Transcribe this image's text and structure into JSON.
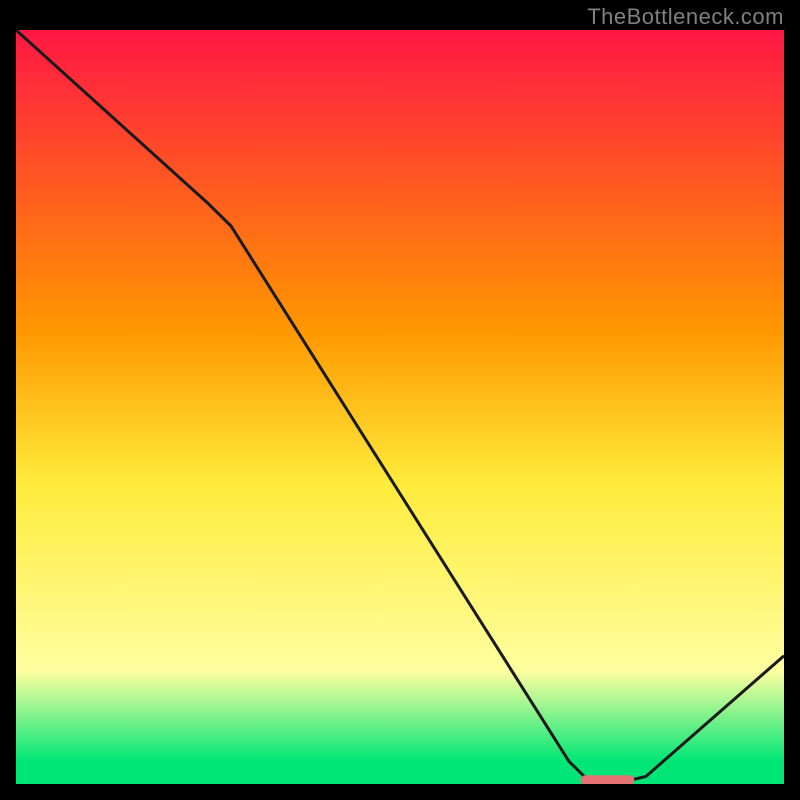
{
  "watermark": "TheBottleneck.com",
  "chart_data": {
    "type": "line",
    "title": "",
    "xlabel": "",
    "ylabel": "",
    "xlim": [
      0,
      100
    ],
    "ylim": [
      0,
      100
    ],
    "gradient_stops": [
      {
        "offset": 0,
        "color": "#ff1744"
      },
      {
        "offset": 40,
        "color": "#ff9800"
      },
      {
        "offset": 60,
        "color": "#ffeb3b"
      },
      {
        "offset": 85,
        "color": "#ffffa0"
      },
      {
        "offset": 97,
        "color": "#00e676"
      }
    ],
    "series": [
      {
        "name": "curve",
        "points": [
          {
            "x": 0,
            "y": 100
          },
          {
            "x": 25,
            "y": 77
          },
          {
            "x": 28,
            "y": 74
          },
          {
            "x": 72,
            "y": 3
          },
          {
            "x": 74,
            "y": 1
          },
          {
            "x": 76,
            "y": 0.5
          },
          {
            "x": 80,
            "y": 0.5
          },
          {
            "x": 82,
            "y": 1
          },
          {
            "x": 100,
            "y": 17
          }
        ]
      }
    ],
    "marker": {
      "x": 77,
      "y": 0.5,
      "width": 7,
      "height": 1.3,
      "color": "#e57373"
    }
  }
}
